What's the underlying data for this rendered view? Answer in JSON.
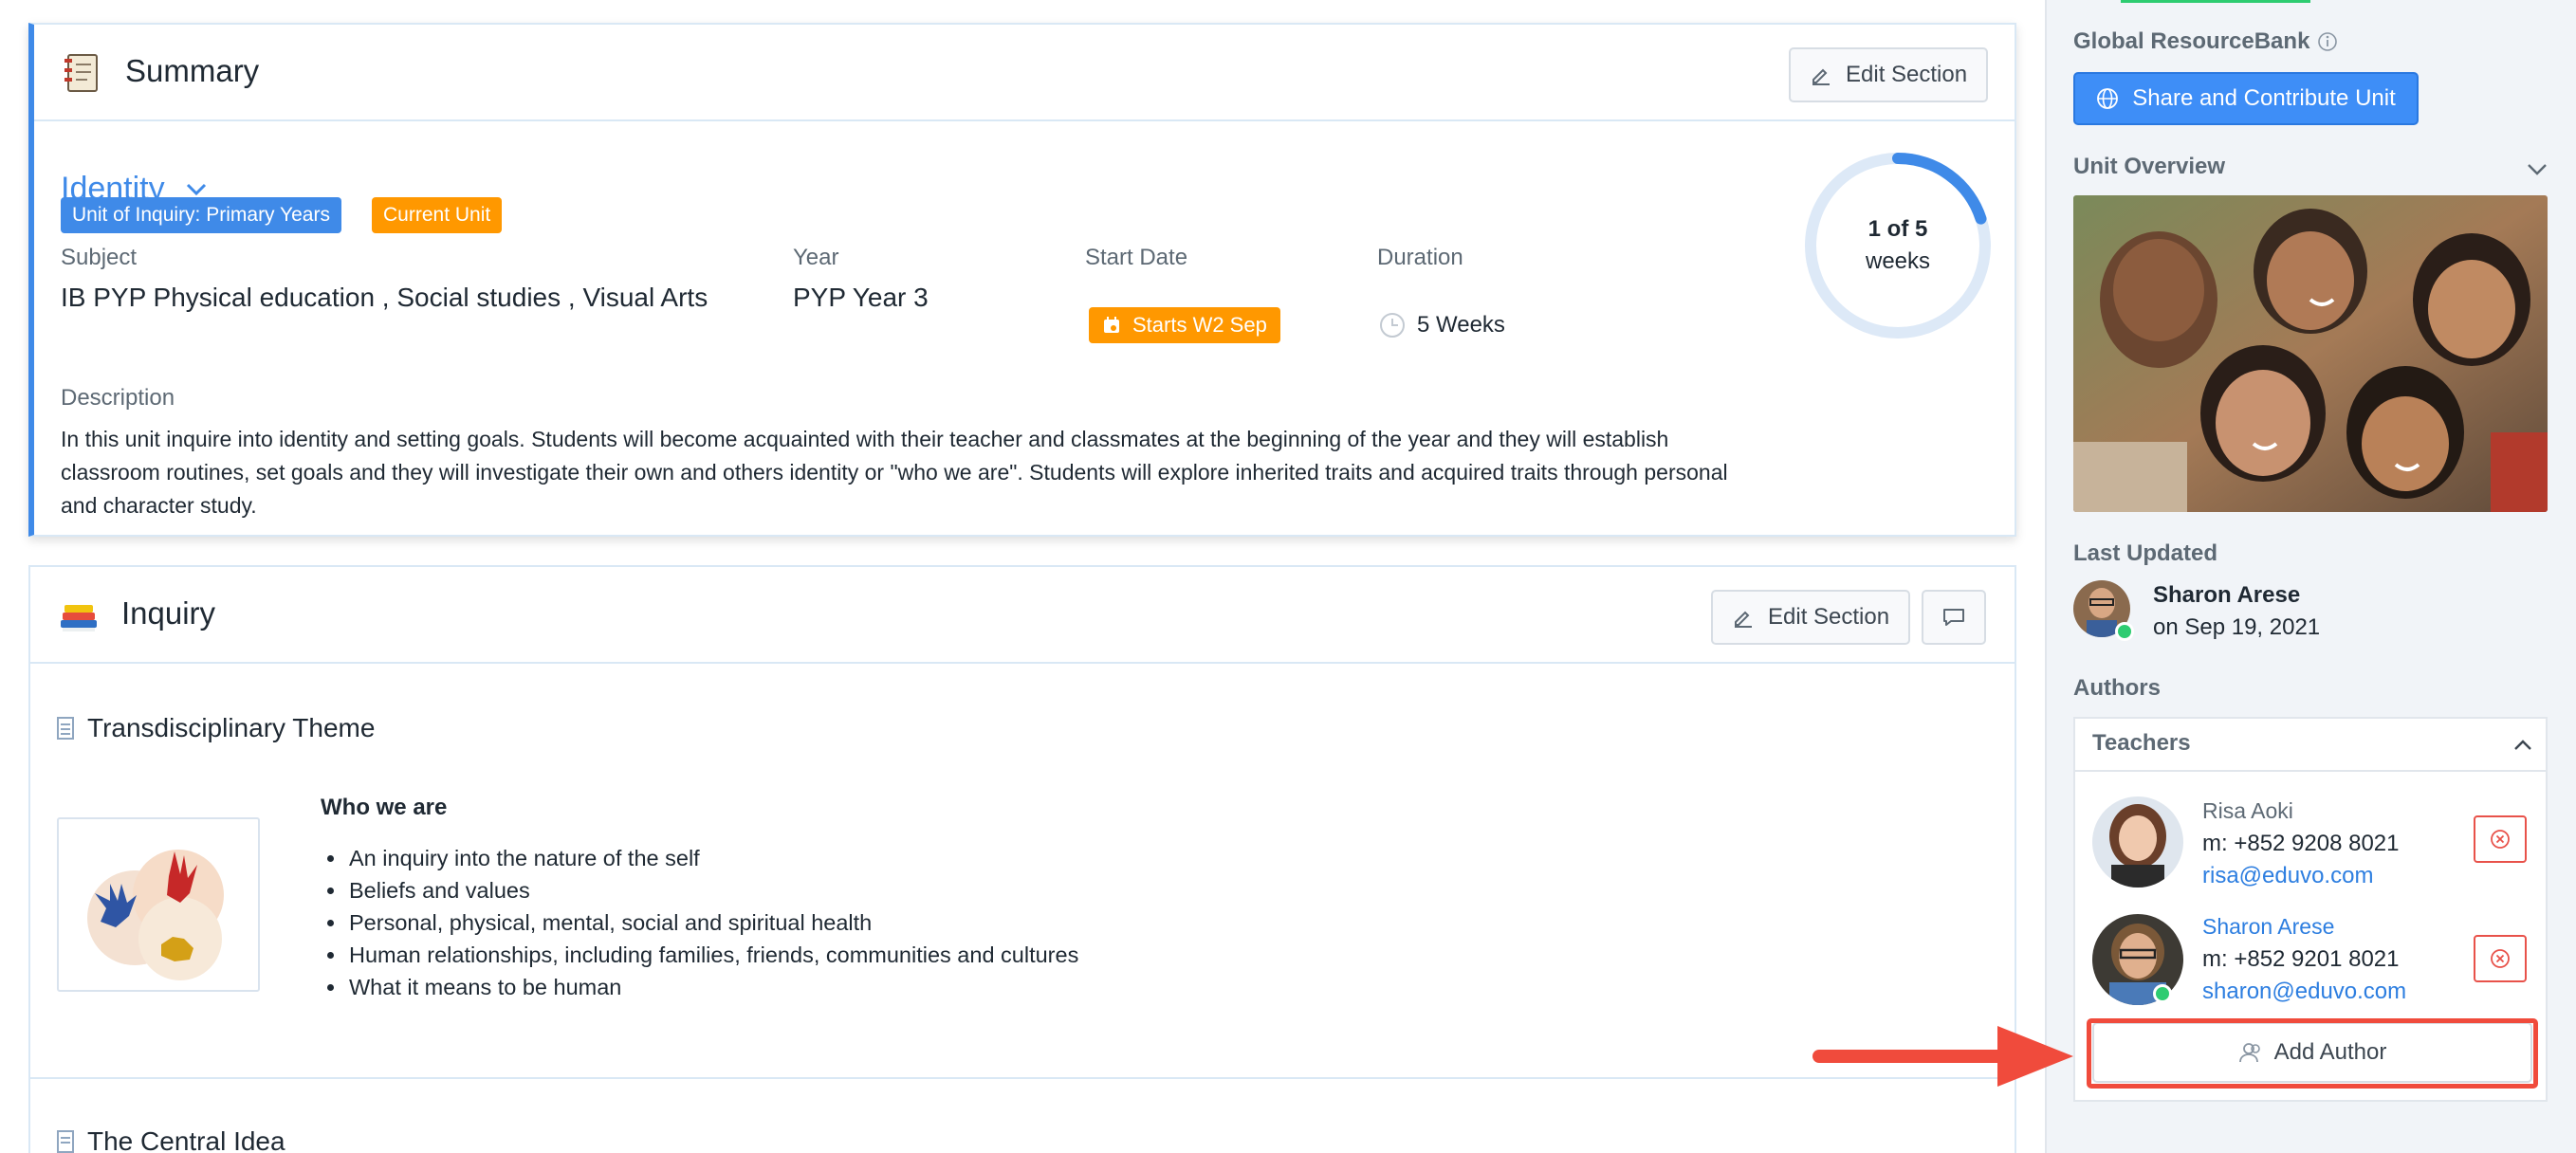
{
  "summary": {
    "header_title": "Summary",
    "edit_label": "Edit Section",
    "unit_title": "Identity",
    "badges": [
      "Unit of Inquiry: Primary Years",
      "Current Unit"
    ],
    "subject_label": "Subject",
    "subject_value": "IB PYP Physical education , Social studies , Visual Arts",
    "year_label": "Year",
    "year_value": "PYP Year 3",
    "start_label": "Start Date",
    "start_value": "Starts W2 Sep",
    "duration_label": "Duration",
    "duration_value": "5 Weeks",
    "progress_line1": "1 of 5",
    "progress_line2": "weeks",
    "progress_fraction": 0.2,
    "description_label": "Description",
    "description_text": "In this unit inquire into identity and setting goals. Students will become acquainted with their teacher and classmates at the beginning of the year and they will establish classroom routines, set goals and they will investigate their own and others identity or \"who we are\". Students will explore inherited traits and acquired traits through personal and character study."
  },
  "inquiry": {
    "header_title": "Inquiry",
    "edit_label": "Edit Section",
    "theme_title": "Transdisciplinary Theme",
    "theme_heading": "Who we are",
    "theme_items": [
      "An inquiry into the nature of the self",
      "Beliefs and values",
      "Personal, physical, mental, social and spiritual health",
      "Human relationships, including families, friends, communities and cultures",
      "What it means to be human"
    ],
    "central_title": "The Central Idea"
  },
  "sidebar": {
    "resourcebank_label": "Global ResourceBank",
    "share_label": "Share and Contribute Unit",
    "overview_label": "Unit Overview",
    "last_updated_label": "Last Updated",
    "last_updated_name": "Sharon Arese",
    "last_updated_date": "on Sep 19, 2021",
    "authors_label": "Authors",
    "teachers_label": "Teachers",
    "teachers": [
      {
        "name": "Risa Aoki",
        "phone": "m: +852 9208 8021",
        "email": "risa@eduvo.com"
      },
      {
        "name": "Sharon Arese",
        "phone": "m: +852 9201 8021",
        "email": "sharon@eduvo.com"
      }
    ],
    "add_author_label": "Add Author"
  },
  "colors": {
    "accent": "#3f8ae8",
    "current_badge": "#ff9800",
    "program_badge": "#3f8ae8",
    "highlight": "#f04b3c",
    "online": "#2ecc71"
  },
  "icons": [
    "notebook-icon",
    "books-icon",
    "calendar-icon",
    "chevron-down-icon",
    "pencil-icon",
    "comment-icon",
    "clock-icon",
    "globe-icon",
    "info-icon",
    "document-icon",
    "remove-icon",
    "add-user-icon",
    "chevron-up-icon",
    "arrow-icon"
  ]
}
